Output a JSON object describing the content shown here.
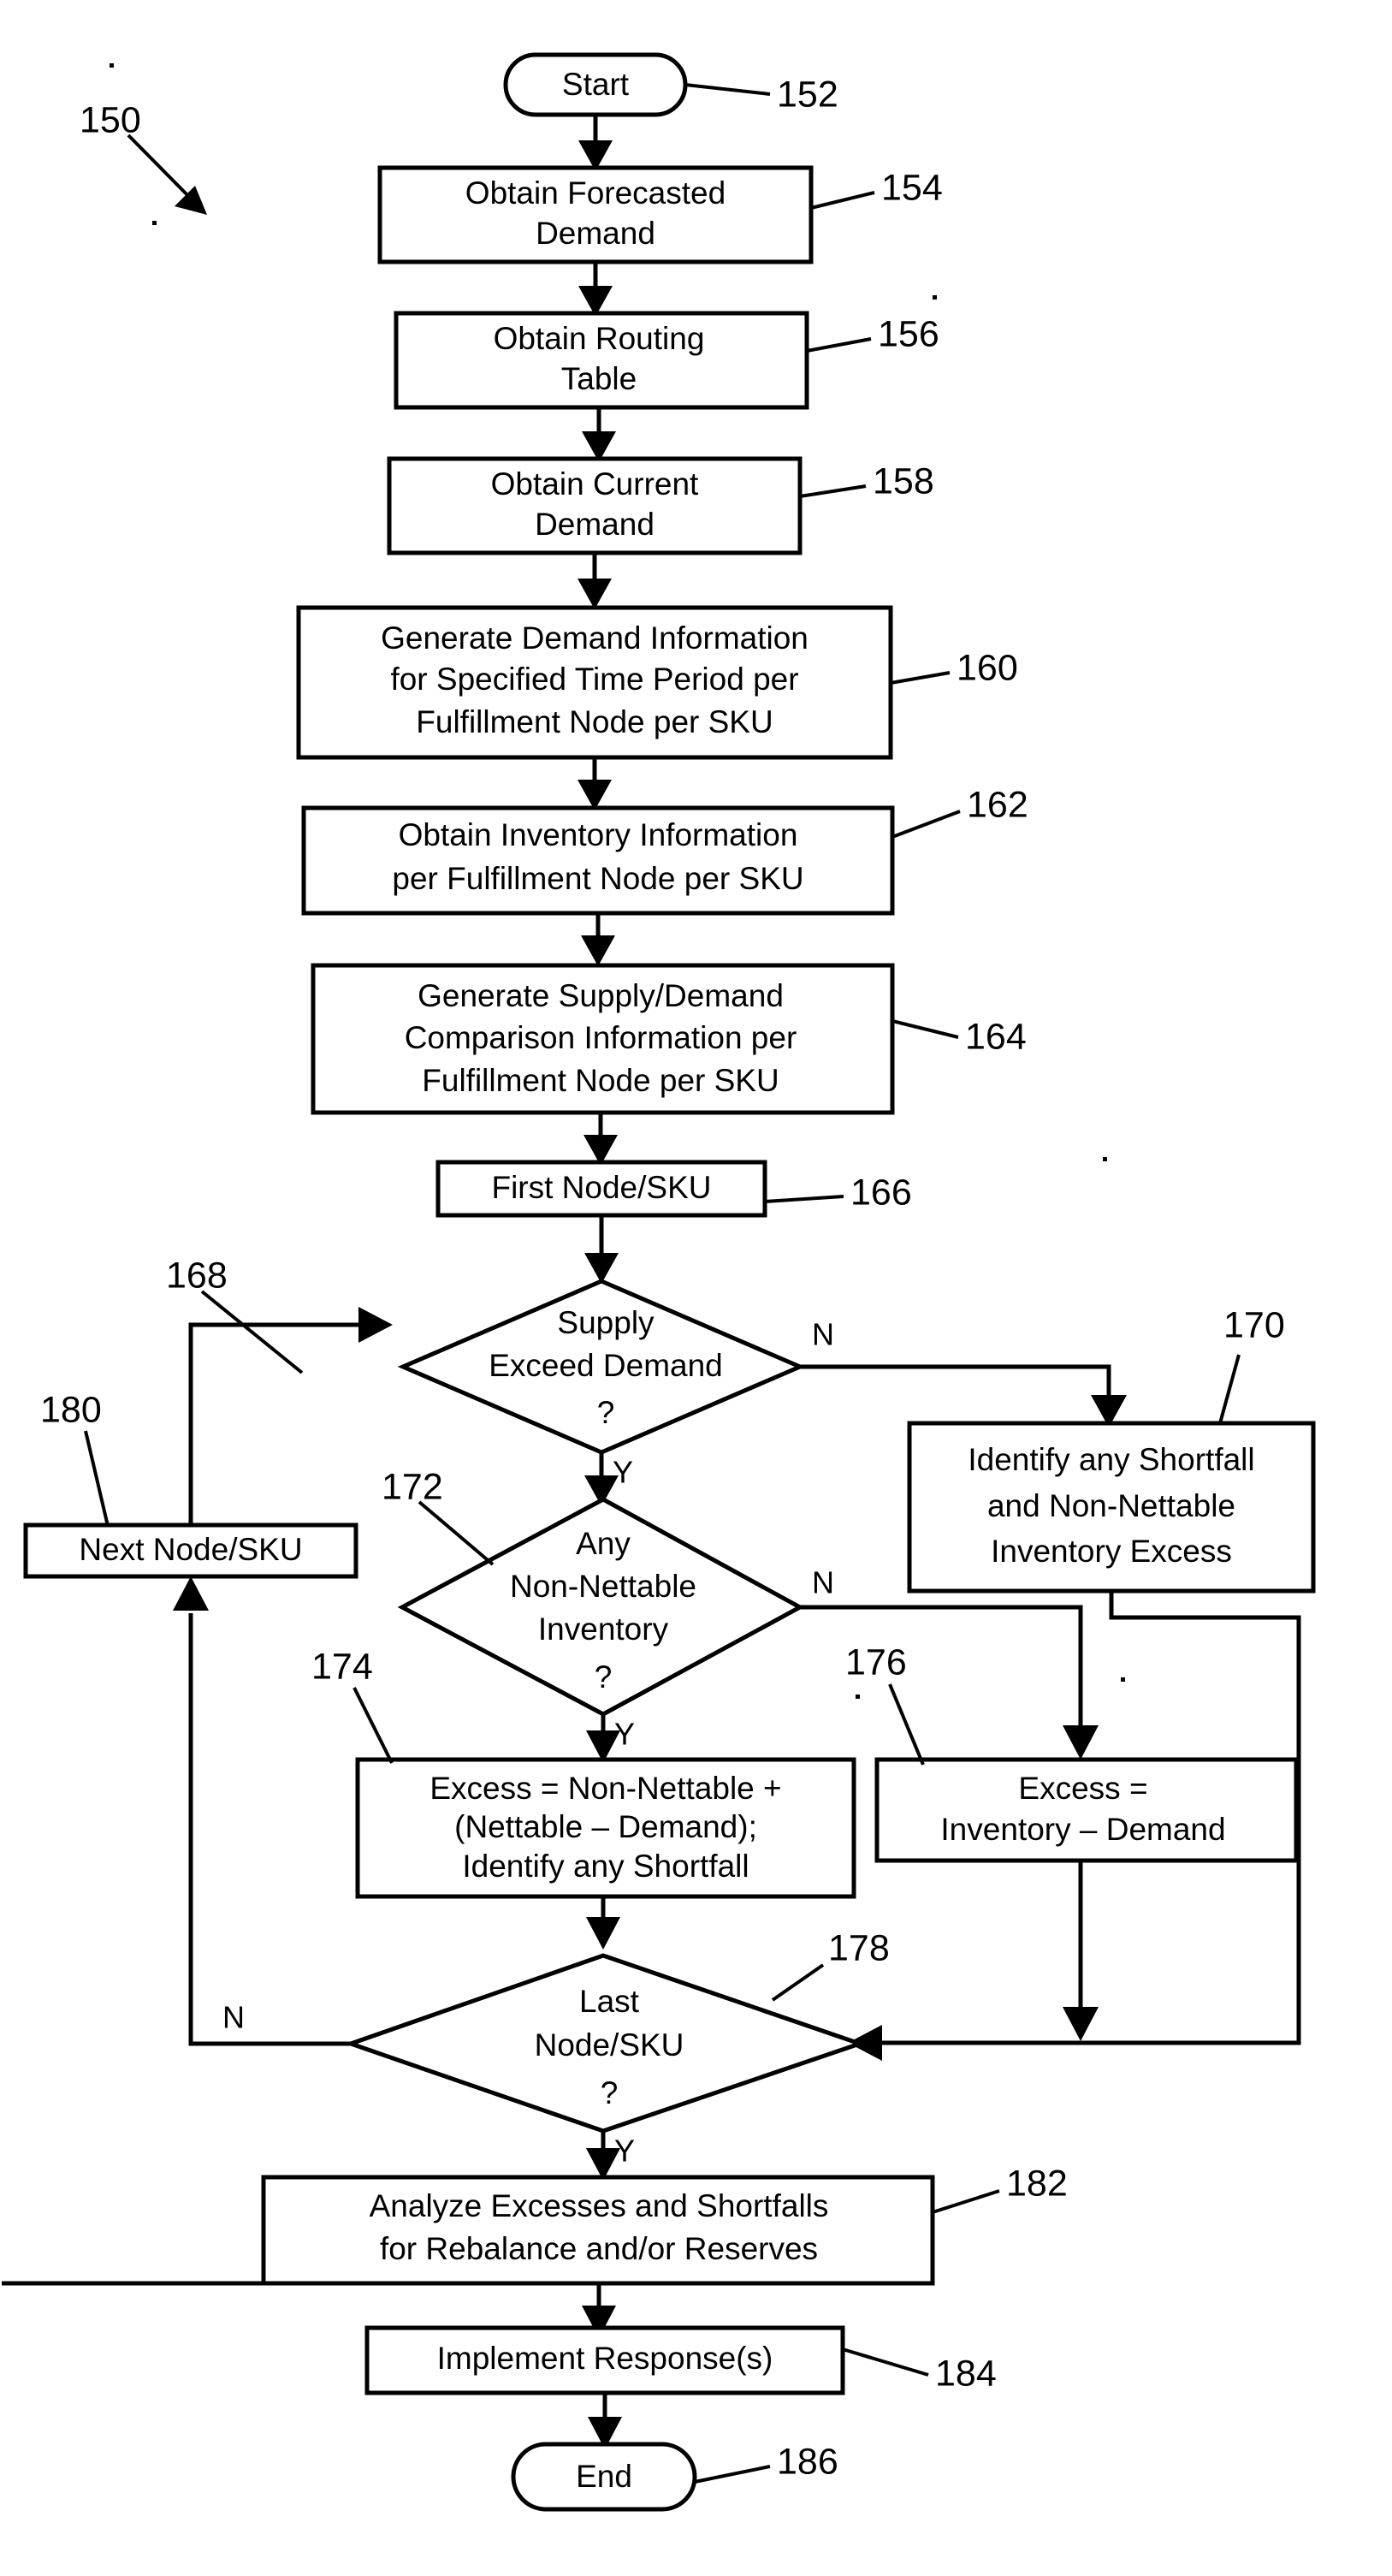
{
  "figure": {
    "figure_ref": "150",
    "nodes": [
      {
        "id": "152",
        "type": "terminator",
        "label": "Start"
      },
      {
        "id": "154",
        "type": "process",
        "lines": [
          "Obtain Forecasted",
          "Demand"
        ]
      },
      {
        "id": "156",
        "type": "process",
        "lines": [
          "Obtain Routing",
          "Table"
        ]
      },
      {
        "id": "158",
        "type": "process",
        "lines": [
          "Obtain Current",
          "Demand"
        ]
      },
      {
        "id": "160",
        "type": "process",
        "lines": [
          "Generate Demand Information",
          "for Specified Time Period per",
          "Fulfillment Node per SKU"
        ]
      },
      {
        "id": "162",
        "type": "process",
        "lines": [
          "Obtain Inventory Information",
          "per Fulfillment Node per SKU"
        ]
      },
      {
        "id": "164",
        "type": "process",
        "lines": [
          "Generate Supply/Demand",
          "Comparison Information per",
          "Fulfillment Node per SKU"
        ]
      },
      {
        "id": "166",
        "type": "process",
        "lines": [
          "First Node/SKU"
        ]
      },
      {
        "id": "168",
        "type": "decision",
        "lines": [
          "Supply",
          "Exceed Demand",
          "?"
        ]
      },
      {
        "id": "170",
        "type": "process",
        "lines": [
          "Identify any Shortfall",
          "and Non-Nettable",
          "Inventory Excess"
        ]
      },
      {
        "id": "172",
        "type": "decision",
        "lines": [
          "Any",
          "Non-Nettable",
          "Inventory",
          "?"
        ]
      },
      {
        "id": "174",
        "type": "process",
        "lines": [
          "Excess = Non-Nettable +",
          "(Nettable – Demand);",
          "Identify any Shortfall"
        ]
      },
      {
        "id": "176",
        "type": "process",
        "lines": [
          "Excess =",
          "Inventory – Demand"
        ]
      },
      {
        "id": "178",
        "type": "decision",
        "lines": [
          "Last",
          "Node/SKU",
          "?"
        ]
      },
      {
        "id": "180",
        "type": "process",
        "lines": [
          "Next Node/SKU"
        ]
      },
      {
        "id": "182",
        "type": "process",
        "lines": [
          "Analyze Excesses and Shortfalls",
          "for Rebalance and/or Reserves"
        ]
      },
      {
        "id": "184",
        "type": "process",
        "lines": [
          "Implement Response(s)"
        ]
      },
      {
        "id": "186",
        "type": "terminator",
        "label": "End"
      }
    ],
    "branch_labels": {
      "d168_no": "N",
      "d168_yes": "Y",
      "d172_no": "N",
      "d172_yes": "Y",
      "d178_no": "N",
      "d178_yes": "Y"
    },
    "colors": {
      "ink": "#000000",
      "paper": "#ffffff"
    }
  }
}
